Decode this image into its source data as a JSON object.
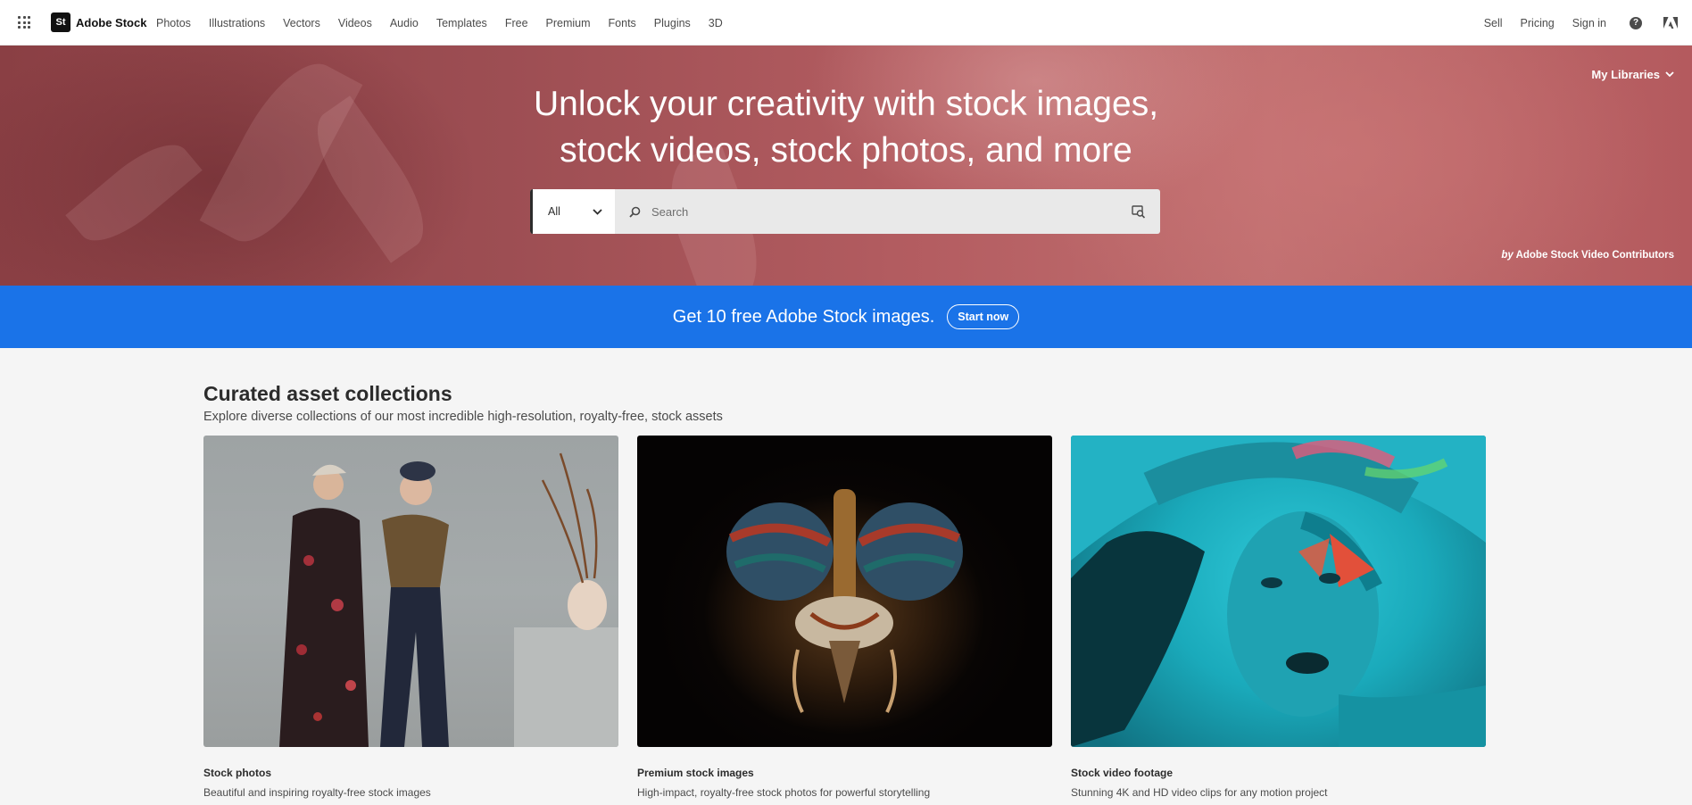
{
  "nav": {
    "brand_logo": "St",
    "brand_name": "Adobe Stock",
    "links": [
      "Photos",
      "Illustrations",
      "Vectors",
      "Videos",
      "Audio",
      "Templates",
      "Free",
      "Premium",
      "Fonts",
      "Plugins",
      "3D"
    ],
    "right": {
      "sell": "Sell",
      "pricing": "Pricing",
      "sign_in": "Sign in",
      "help_glyph": "?"
    }
  },
  "hero": {
    "title_line1": "Unlock your creativity with stock images,",
    "title_line2": "stock videos, stock photos, and more",
    "my_libraries": "My Libraries",
    "search": {
      "filter_value": "All",
      "placeholder": "Search"
    },
    "credit_by": "by",
    "credit_name": "Adobe Stock Video Contributors"
  },
  "promo": {
    "text": "Get 10 free Adobe Stock images.",
    "button": "Start now",
    "background": "#1a73e8"
  },
  "collections": {
    "title": "Curated asset collections",
    "subtitle": "Explore diverse collections of our most incredible high-resolution, royalty-free, stock assets",
    "items": [
      {
        "title": "Stock photos",
        "desc": "Beautiful and inspiring royalty-free stock images"
      },
      {
        "title": "Premium stock images",
        "desc": "High-impact, royalty-free stock photos for powerful storytelling"
      },
      {
        "title": "Stock video footage",
        "desc": "Stunning 4K and HD video clips for any motion project"
      }
    ]
  },
  "icons": {
    "apps": "app-grid-icon",
    "chevron": "chevron-down-icon",
    "search": "search-icon",
    "visual_search": "visual-search-icon",
    "help": "help-icon",
    "adobe": "adobe-logo-icon"
  }
}
